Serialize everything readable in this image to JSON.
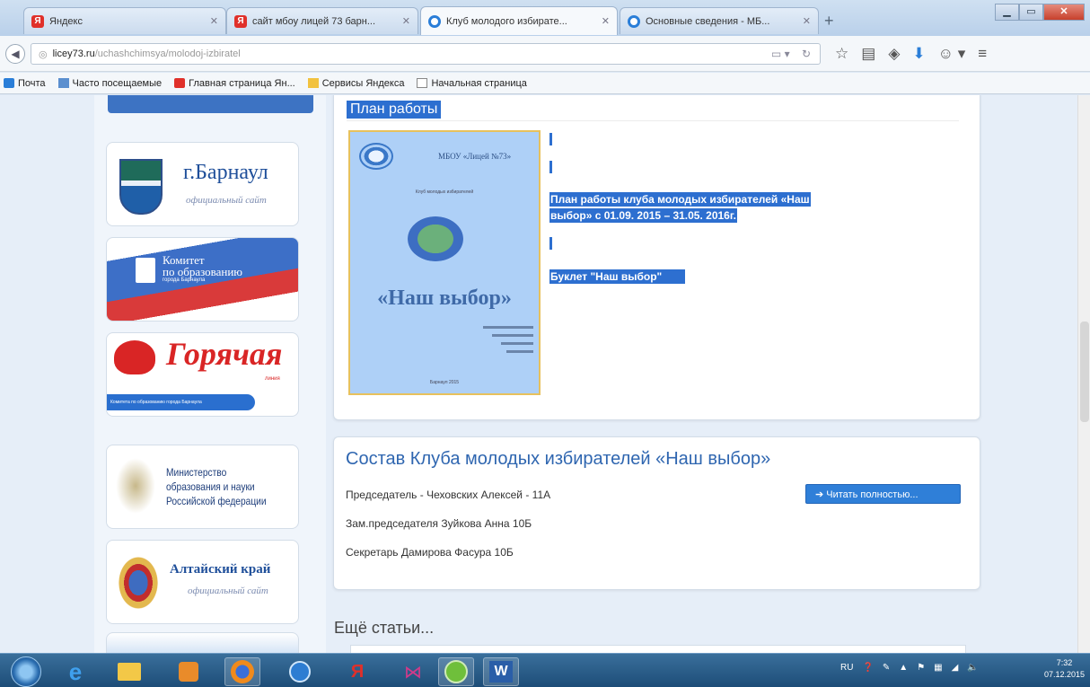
{
  "browser": {
    "tabs": [
      {
        "label": "Яндекс",
        "favicon": "yandex-icon"
      },
      {
        "label": "сайт мбоу лицей 73 барн...",
        "favicon": "yandex-icon"
      },
      {
        "label": "Клуб молодого избирате...",
        "favicon": "site-icon"
      },
      {
        "label": "Основные сведения - МБ...",
        "favicon": "site-icon"
      }
    ],
    "new_tab": "+",
    "url_host": "licey73.ru",
    "url_path": "/uchashchimsya/molodoj-izbiratel",
    "bookmarks": [
      "Почта",
      "Часто посещаемые",
      "Главная страница Ян...",
      "Сервисы Яндекса",
      "Начальная страница"
    ]
  },
  "sidebar": {
    "barnaul": {
      "title": "г.Барнаул",
      "subtitle": "официальный сайт"
    },
    "komitet": {
      "line1": "Комитет",
      "line2": "по образованию",
      "line3": "города Барнаула"
    },
    "hotline": {
      "title": "Горячая",
      "small": "линия",
      "pill": "Комитета по образованию города Барнаула"
    },
    "ministry": {
      "line1": "Министерство",
      "line2": "образования и науки",
      "line3": "Российской федерации"
    },
    "altai": {
      "title": "Алтайский край",
      "subtitle": "официальный сайт"
    }
  },
  "main": {
    "plan_title": "План работы",
    "booklet": {
      "school": "МБОУ «Лицей №73»",
      "club": "Клуб молодых избирателей",
      "title": "«Наш выбор»",
      "year": "Барнаул 2015"
    },
    "plan_link_line1": "План работы клуба молодых избирателей «Наш",
    "plan_link_line2": "выбор» с 01.09. 2015 – 31.05. 2016г.",
    "booklet_link": "Буклет \"Наш выбор\"",
    "club_title": "Состав Клуба молодых избирателей «Наш выбор»",
    "members": [
      "Председатель - Чеховских Алексей - 11А",
      "Зам.председателя  Зуйкова Анна  10Б",
      "Секретарь Дамирова Фасура 10Б"
    ],
    "read_more": "➔ Читать полностью...",
    "more_articles": "Ещё статьи..."
  },
  "taskbar": {
    "lang": "RU",
    "time": "7:32",
    "date": "07.12.2015"
  },
  "colors": {
    "accent": "#2d6fd0",
    "heading": "#2f66b0",
    "page_bg": "#e6eef8"
  }
}
